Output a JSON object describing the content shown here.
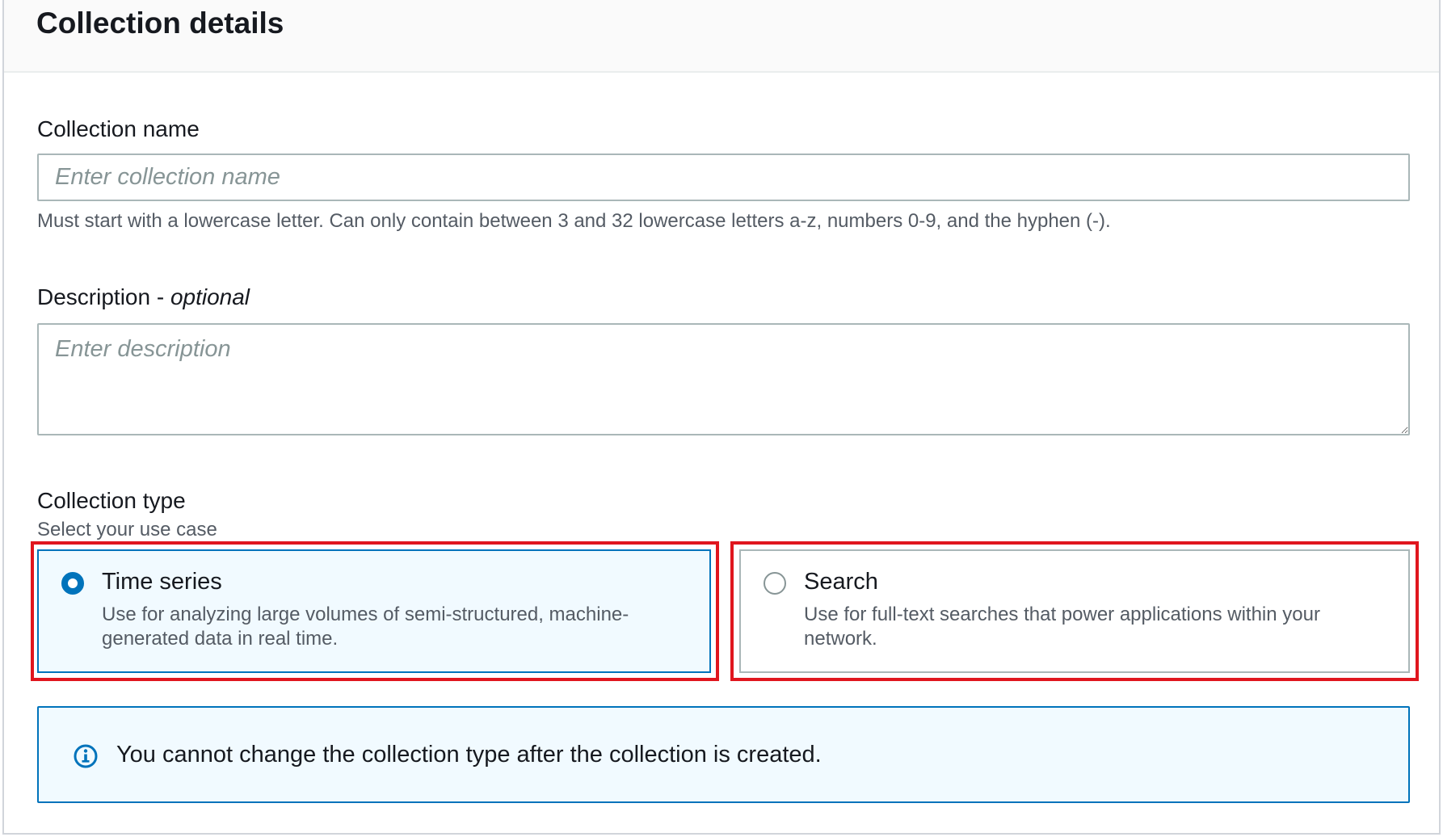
{
  "panel": {
    "title": "Collection details"
  },
  "collection_name": {
    "label": "Collection name",
    "value": "",
    "placeholder": "Enter collection name",
    "hint": "Must start with a lowercase letter. Can only contain between 3 and 32 lowercase letters a-z, numbers 0-9, and the hyphen (-)."
  },
  "description": {
    "label": "Description - ",
    "label_optional": "optional",
    "value": "",
    "placeholder": "Enter description"
  },
  "collection_type": {
    "label": "Collection type",
    "sublabel": "Select your use case",
    "selected": "Time series",
    "options": [
      {
        "title": "Time series",
        "description": "Use for analyzing large volumes of semi-structured, machine-generated data in real time."
      },
      {
        "title": "Search",
        "description": "Use for full-text searches that power applications within your network."
      }
    ]
  },
  "info": {
    "icon": "info-icon",
    "text": "You cannot change the collection type after the collection is created."
  },
  "colors": {
    "accent": "#0073bb",
    "highlight": "#e0161e",
    "selected_bg": "#f1faff"
  }
}
